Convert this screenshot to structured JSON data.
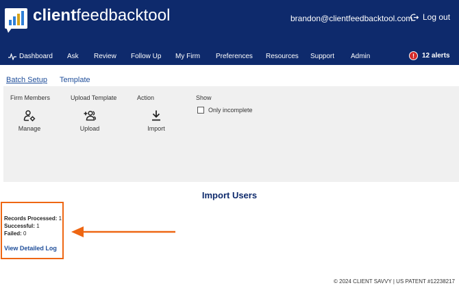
{
  "header": {
    "brand_bold": "client",
    "brand_light": "feedbacktool",
    "email": "brandon@clientfeedbacktool.com",
    "logout_label": "Log out"
  },
  "nav": {
    "items": [
      {
        "label": "Dashboard",
        "icon": "pulse-icon"
      },
      {
        "label": "Ask"
      },
      {
        "label": "Review"
      },
      {
        "label": "Follow Up"
      },
      {
        "label": "My Firm"
      },
      {
        "label": "Preferences"
      },
      {
        "label": "Resources"
      },
      {
        "label": "Support"
      },
      {
        "label": "Admin"
      }
    ],
    "alerts_label": "12 alerts",
    "alerts_icon": "!"
  },
  "tabs": [
    {
      "label": "Batch Setup",
      "active": true
    },
    {
      "label": "Template",
      "active": false
    }
  ],
  "toolbar": {
    "columns": [
      {
        "heading": "Firm Members",
        "action_label": "Manage",
        "icon": "user-gear-icon"
      },
      {
        "heading": "Upload Template",
        "action_label": "Upload",
        "icon": "add-users-icon"
      },
      {
        "heading": "Action",
        "action_label": "Import",
        "icon": "download-icon"
      }
    ],
    "show_heading": "Show",
    "only_incomplete_label": "Only incomplete",
    "only_incomplete_checked": false
  },
  "import": {
    "title": "Import Users",
    "records_processed_label": "Records Processed:",
    "records_processed_value": "1",
    "successful_label": "Successful:",
    "successful_value": "1",
    "failed_label": "Failed:",
    "failed_value": "0",
    "log_link": "View Detailed Log"
  },
  "colors": {
    "header_bg": "#0e2a6c",
    "link": "#1f4e9a",
    "highlight": "#ee6612",
    "alert": "#d42a2a"
  },
  "footer": {
    "text": "© 2024 CLIENT SAVVY | US PATENT #12238217"
  }
}
